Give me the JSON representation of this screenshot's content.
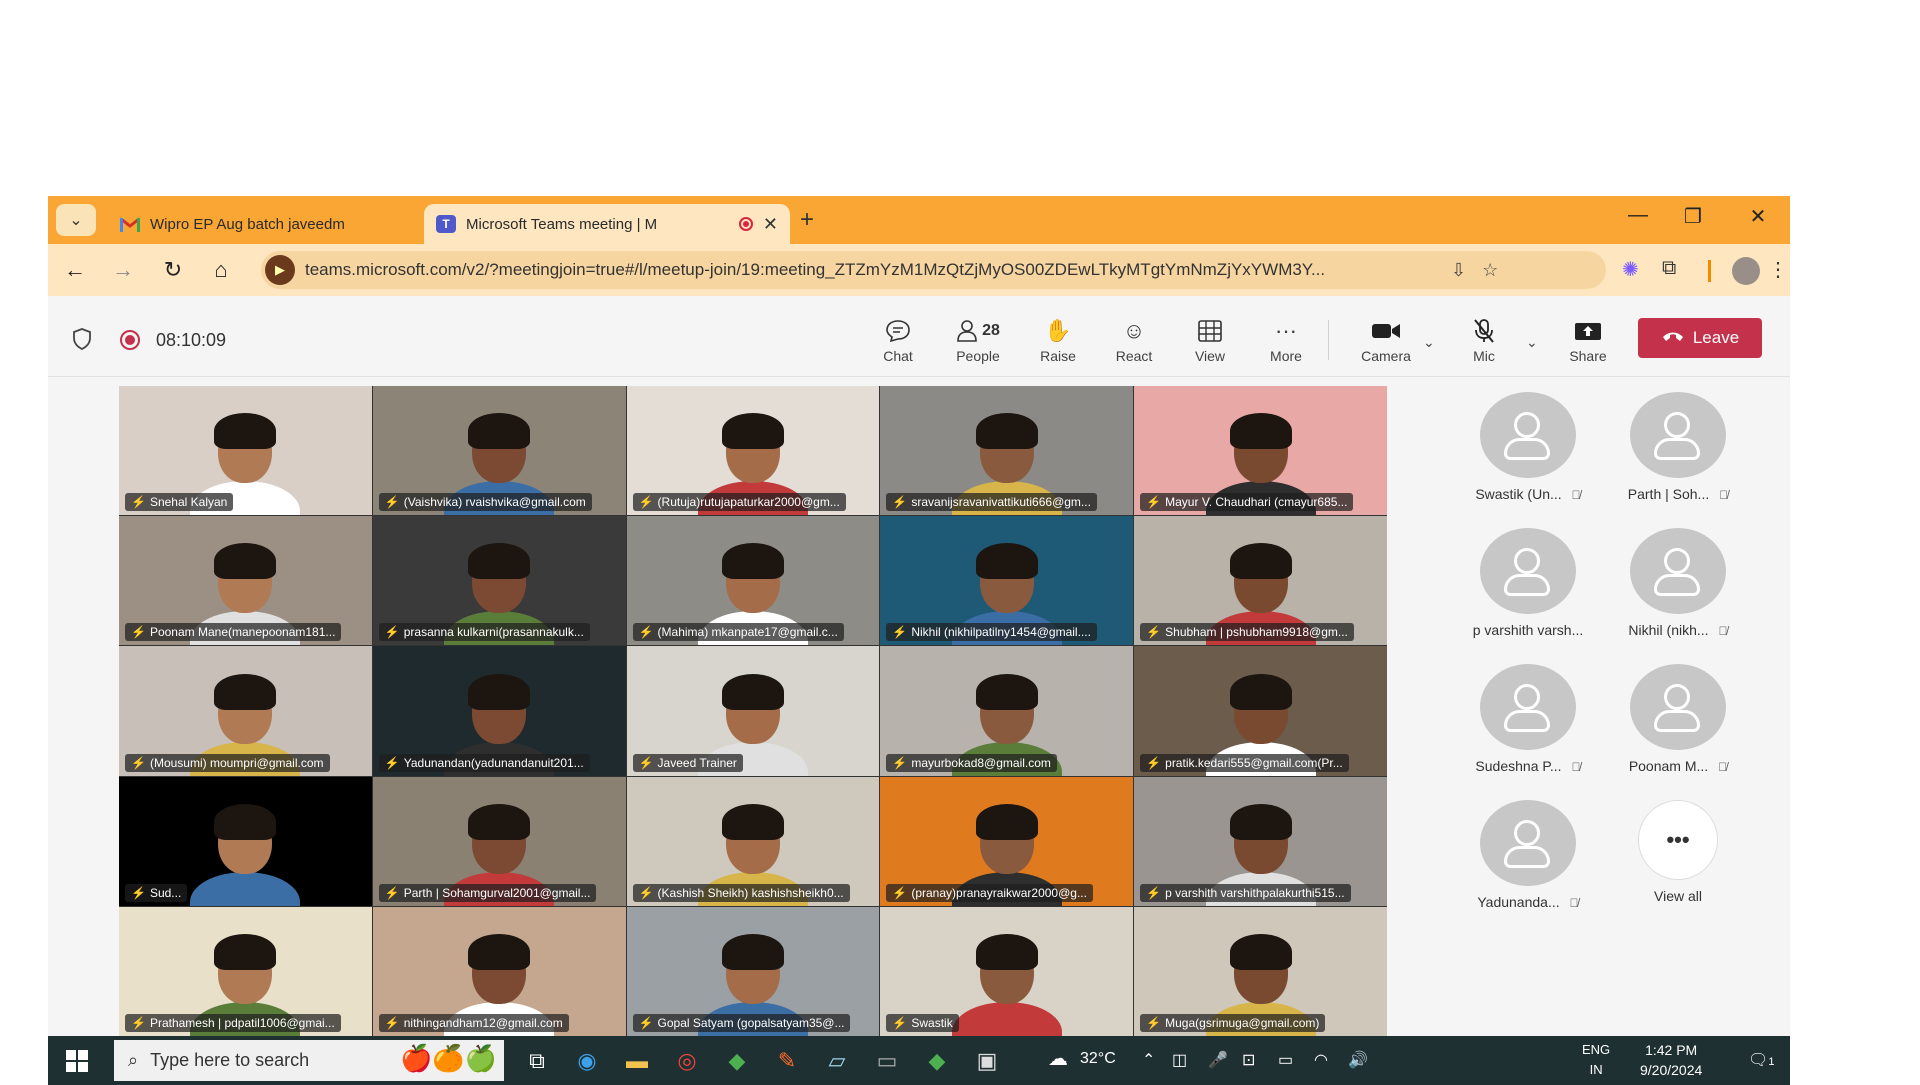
{
  "browser": {
    "menu_glyph": "⌄",
    "tabs": [
      {
        "title": "Wipro EP Aug batch  javeedm",
        "close": "✕"
      },
      {
        "title": "Microsoft Teams meeting | M",
        "close": "✕"
      }
    ],
    "new_tab": "+",
    "window_controls": {
      "minimize": "—",
      "restore": "❐",
      "close": "✕"
    },
    "url": "teams.microsoft.com/v2/?meetingjoin=true#/l/meetup-join/19:meeting_ZTZmYzM1MzQtZjMyOS00ZDEwLTkyMTgtYmNmZjYxYWM3Y..."
  },
  "meeting": {
    "timer": "08:10:09",
    "toolbar": {
      "chat": "Chat",
      "people": "People",
      "people_count": "28",
      "raise": "Raise",
      "react": "React",
      "view": "View",
      "more": "More",
      "camera": "Camera",
      "mic": "Mic",
      "share": "Share",
      "leave": "Leave"
    },
    "tiles": [
      {
        "name": "Snehal Kalyan"
      },
      {
        "name": "(Vaishvika) rvaishvika@gmail.com"
      },
      {
        "name": "(Rutuja)rutujapaturkar2000@gm..."
      },
      {
        "name": "sravanijsravanivattikuti666@gm..."
      },
      {
        "name": "Mayur V. Chaudhari (cmayur685..."
      },
      {
        "name": "Poonam Mane(manepoonam181..."
      },
      {
        "name": "prasanna kulkarni(prasannakulk..."
      },
      {
        "name": "(Mahima) mkanpate17@gmail.c..."
      },
      {
        "name": "Nikhil (nikhilpatilny1454@gmail...."
      },
      {
        "name": "Shubham | pshubham9918@gm..."
      },
      {
        "name": "(Mousumi) moumpri@gmail.com"
      },
      {
        "name": "Yadunandan(yadunandanuit201..."
      },
      {
        "name": "Javeed Trainer"
      },
      {
        "name": "mayurbokad8@gmail.com"
      },
      {
        "name": "pratik.kedari555@gmail.com(Pr..."
      },
      {
        "name": "Sud..."
      },
      {
        "name": "Parth | Sohamgurval2001@gmail..."
      },
      {
        "name": "(Kashish Sheikh) kashishsheikh0..."
      },
      {
        "name": "(pranay)pranayraikwar2000@g..."
      },
      {
        "name": "p varshith varshithpalakurthi515..."
      },
      {
        "name": "Prathamesh | pdpatil1006@gmai..."
      },
      {
        "name": "nithingandham12@gmail.com"
      },
      {
        "name": "Gopal Satyam (gopalsatyam35@..."
      },
      {
        "name": "Swastik"
      },
      {
        "name": "Muga(gsrimuga@gmail.com)"
      }
    ],
    "side_participants": [
      {
        "name": "Swastik (Un..."
      },
      {
        "name": "Parth | Soh..."
      },
      {
        "name": "p varshith varsh..."
      },
      {
        "name": "Nikhil (nikh..."
      },
      {
        "name": "Sudeshna P..."
      },
      {
        "name": "Poonam M..."
      },
      {
        "name": "Yadunanda..."
      }
    ],
    "view_all": "View all",
    "view_all_glyph": "•••"
  },
  "taskbar": {
    "search_placeholder": "Type here to search",
    "weather": "32°C",
    "lang_line1": "ENG",
    "lang_line2": "IN",
    "time": "1:42 PM",
    "date": "9/20/2024",
    "notification_count": "1"
  },
  "colors": {
    "tabstrip": "#f9a635",
    "leave_button": "#c4314b",
    "taskbar": "#1f3033"
  }
}
